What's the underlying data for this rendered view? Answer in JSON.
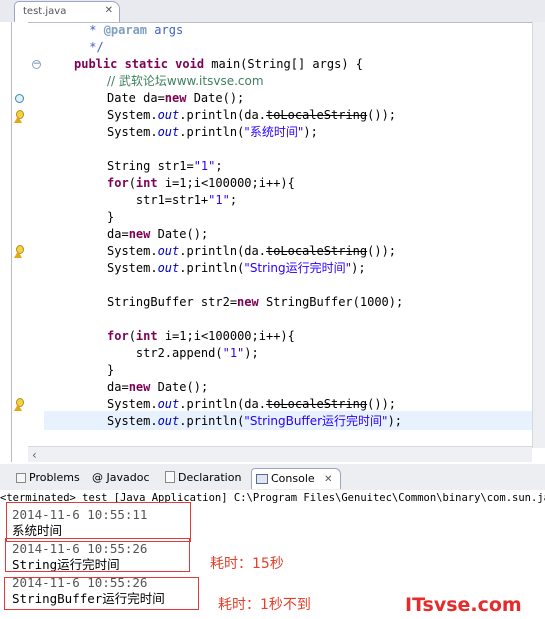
{
  "editor": {
    "tab_label": "test.java",
    "tab_close": "✕",
    "lines": {
      "l1_star": " * ",
      "l1_tag": "@param",
      "l1_rest": " args",
      "l2": " */",
      "l3_kw": "public static void",
      "l3_rest": " main(String[] args) {",
      "l4_comment": "// 武软论坛www.itsvse.com",
      "l5_kw": "Date da=",
      "l5_new": "new",
      "l5_rest": " Date();",
      "l6_pre": "System.",
      "l6_out": "out",
      "l6_mid": ".println(da.",
      "l6_dep": "toLocaleString",
      "l6_end": "());",
      "l7_pre": "System.",
      "l7_out": "out",
      "l7_mid": ".println(",
      "l7_str": "\"系统时间\"",
      "l7_end": ");",
      "l9_pre": "String str1=",
      "l9_str": "\"1\"",
      "l9_end": ";",
      "l10_for": "for",
      "l10_a": "(",
      "l10_int": "int",
      "l10_rest": " i=1;i<100000;i++){",
      "l11_pre": "    str1=str1+",
      "l11_str": "\"1\"",
      "l11_end": ";",
      "l12": "}",
      "l13_pre": "da=",
      "l13_new": "new",
      "l13_rest": " Date();",
      "l14_pre": "System.",
      "l14_out": "out",
      "l14_mid": ".println(da.",
      "l14_dep": "toLocaleString",
      "l14_end": "());",
      "l15_pre": "System.",
      "l15_out": "out",
      "l15_mid": ".println(",
      "l15_str": "\"String运行完时间\"",
      "l15_end": ");",
      "l17_pre": "StringBuffer str2=",
      "l17_new": "new",
      "l17_rest": " StringBuffer(1000);",
      "l19_for": "for",
      "l19_a": "(",
      "l19_int": "int",
      "l19_rest": " i=1;i<100000;i++){",
      "l20_pre": "    str2.append(",
      "l20_str": "\"1\"",
      "l20_end": ");",
      "l21": "}",
      "l22_pre": "da=",
      "l22_new": "new",
      "l22_rest": " Date();",
      "l23_pre": "System.",
      "l23_out": "out",
      "l23_mid": ".println(da.",
      "l23_dep": "toLocaleString",
      "l23_end": "());",
      "l24_pre": "System.",
      "l24_out": "out",
      "l24_mid": ".println(",
      "l24_str": "\"StringBuffer运行完时间\"",
      "l24_end": ");"
    }
  },
  "views": {
    "tabs": [
      {
        "label": "Problems",
        "icon": "problems-icon"
      },
      {
        "label": "@ Javadoc",
        "icon": "javadoc-icon"
      },
      {
        "label": "Declaration",
        "icon": "declaration-icon"
      },
      {
        "label": "Console",
        "icon": "console-icon",
        "close": "✕"
      }
    ],
    "console_header": "<terminated> test [Java Application] C:\\Program Files\\Genuitec\\Common\\binary\\com.sun.java",
    "output": [
      {
        "time": "2014-11-6 10:55:11",
        "text": "系统时间"
      },
      {
        "time": "2014-11-6 10:55:26",
        "text": "String运行完时间"
      },
      {
        "time": "2014-11-6 10:55:26",
        "text": "StringBuffer运行完时间"
      }
    ]
  },
  "annotations": {
    "note1": "耗时：15秒",
    "note2": "耗时：1秒不到",
    "annotation_color": "#e23a3a"
  },
  "watermark": "ITsvse.com"
}
